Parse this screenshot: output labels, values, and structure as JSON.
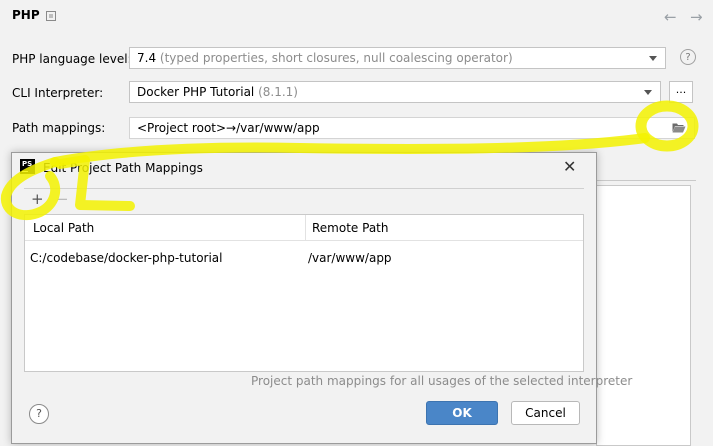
{
  "header": {
    "title": "PHP",
    "reset_icon": "reset-icon",
    "back_icon": "←",
    "forward_icon": "→"
  },
  "settings": {
    "language_level": {
      "label": "PHP language level:",
      "value": "7.4",
      "hint": "(typed properties, short closures, null coalescing operator)"
    },
    "cli_interpreter": {
      "label": "CLI Interpreter:",
      "value": "Docker PHP Tutorial",
      "hint": "(8.1.1)",
      "browse_label": "..."
    },
    "path_mappings": {
      "label": "Path mappings:",
      "value": "<Project root>→/var/www/app"
    },
    "help_label": "?"
  },
  "dialog": {
    "title": "Edit Project Path Mappings",
    "logo_text": "PS",
    "close_label": "✕",
    "add_label": "+",
    "remove_label": "−",
    "columns": [
      "Local Path",
      "Remote Path"
    ],
    "rows": [
      {
        "local": "C:/codebase/docker-php-tutorial",
        "remote": "/var/www/app"
      }
    ],
    "hint": "Project path mappings for all usages of the selected interpreter",
    "help_label": "?",
    "ok_label": "OK",
    "cancel_label": "Cancel"
  },
  "colors": {
    "accent": "#4a86c8",
    "annotation": "#f3f200"
  }
}
